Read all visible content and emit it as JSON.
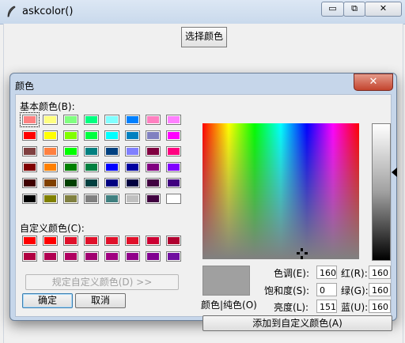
{
  "main": {
    "title": "askcolor()",
    "choose_button": "选择颜色",
    "window_buttons": [
      "▭",
      "⧉",
      "✕"
    ]
  },
  "dialog": {
    "title": "颜色",
    "close": "✕",
    "basic_colors_label": "基本颜色(B):",
    "custom_colors_label": "自定义颜色(C):",
    "define_custom_button": "规定自定义颜色(D) >>",
    "ok_button": "确定",
    "cancel_button": "取消",
    "color_solid_label": "颜色|纯色(O)",
    "hue_label": "色调(E):",
    "hue_value": "160",
    "sat_label": "饱和度(S):",
    "sat_value": "0",
    "lum_label": "亮度(L):",
    "lum_value": "151",
    "red_label": "红(R):",
    "red_value": "160",
    "green_label": "绿(G):",
    "green_value": "160",
    "blue_label": "蓝(U):",
    "blue_value": "160",
    "add_custom_button": "添加到自定义颜色(A)",
    "preview_color": "#a0a0a0",
    "basic_colors": [
      [
        "#ff8080",
        "#ffff80",
        "#80ff80",
        "#00ff80",
        "#80ffff",
        "#0080ff",
        "#ff80c0",
        "#ff80ff"
      ],
      [
        "#ff0000",
        "#ffff00",
        "#80ff00",
        "#00ff40",
        "#00ffff",
        "#0080c0",
        "#8080c0",
        "#ff00ff"
      ],
      [
        "#804040",
        "#ff8040",
        "#00ff00",
        "#008080",
        "#004080",
        "#8080ff",
        "#800040",
        "#ff0080"
      ],
      [
        "#800000",
        "#ff8000",
        "#008000",
        "#008040",
        "#0000ff",
        "#0000a0",
        "#800080",
        "#8000ff"
      ],
      [
        "#400000",
        "#804000",
        "#004000",
        "#004040",
        "#000080",
        "#000040",
        "#400040",
        "#400080"
      ],
      [
        "#000000",
        "#808000",
        "#808040",
        "#808080",
        "#408080",
        "#c0c0c0",
        "#400040",
        "#ffffff"
      ]
    ],
    "custom_colors": [
      [
        "#ff0000",
        "#ff0000",
        "#e0102a",
        "#e0102a",
        "#e0102a",
        "#e0102a",
        "#cc0033",
        "#b00030"
      ],
      [
        "#b00040",
        "#b00050",
        "#b00060",
        "#a00070",
        "#a00080",
        "#90008a",
        "#800090",
        "#7010a0"
      ]
    ]
  }
}
